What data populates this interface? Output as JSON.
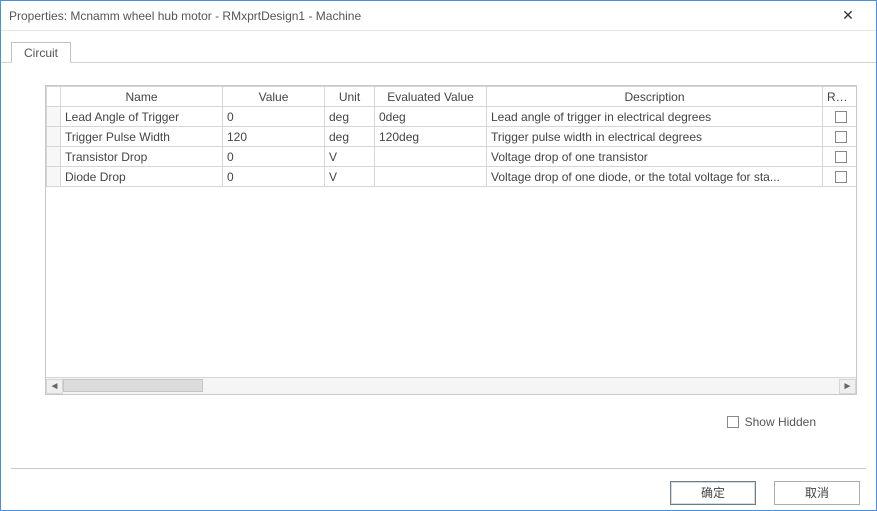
{
  "window": {
    "title": "Properties: Mcnamm wheel hub motor - RMxprtDesign1 - Machine",
    "close_label": "✕"
  },
  "tabs": [
    {
      "label": "Circuit"
    }
  ],
  "grid": {
    "headers": {
      "name": "Name",
      "value": "Value",
      "unit": "Unit",
      "evaluated": "Evaluated Value",
      "description": "Description",
      "read": "Read"
    },
    "rows": [
      {
        "name": "Lead Angle of Trigger",
        "value": "0",
        "unit": "deg",
        "evaluated": "0deg",
        "description": "Lead angle of trigger in electrical degrees"
      },
      {
        "name": "Trigger Pulse Width",
        "value": "120",
        "unit": "deg",
        "evaluated": "120deg",
        "description": "Trigger pulse width in electrical degrees"
      },
      {
        "name": "Transistor Drop",
        "value": "0",
        "unit": "V",
        "evaluated": "",
        "description": "Voltage drop of one transistor"
      },
      {
        "name": "Diode Drop",
        "value": "0",
        "unit": "V",
        "evaluated": "",
        "description": "Voltage drop of one diode, or the total voltage for sta..."
      }
    ]
  },
  "show_hidden": {
    "label": "Show Hidden",
    "checked": false
  },
  "buttons": {
    "ok": "确定",
    "cancel": "取消"
  },
  "scrollbar": {
    "left": "◄",
    "right": "►"
  }
}
